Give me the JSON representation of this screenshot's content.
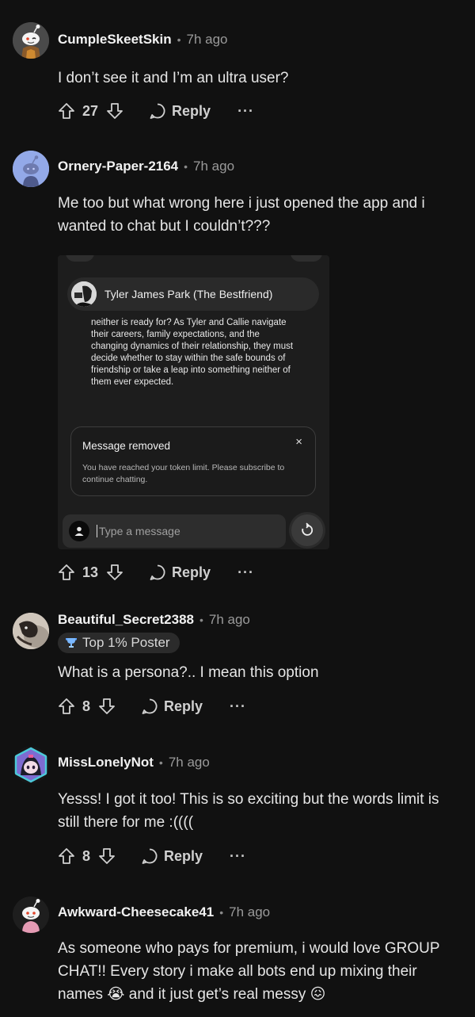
{
  "comments": [
    {
      "author": "CumpleSkeetSkin",
      "time": "7h ago",
      "text": "I don’t see it and I’m an ultra user?",
      "votes": "27",
      "reply_label": "Reply",
      "more_label": "···"
    },
    {
      "author": "Ornery-Paper-2164",
      "time": "7h ago",
      "text": "Me too but what wrong here i just opened the app and i wanted to chat but I couldn’t???",
      "votes": "13",
      "reply_label": "Reply",
      "more_label": "···",
      "screenshot": {
        "character_name": "Tyler James Park (The Bestfriend)",
        "story_text": "neither is ready for? As Tyler and Callie navigate their careers, family expectations, and the changing dynamics of their relationship, they must decide whether to stay within the safe bounds of friendship or take a leap into something neither of them ever expected.",
        "notice_title": "Message removed",
        "notice_close": "×",
        "notice_text": "You have reached your token limit. Please subscribe to continue chatting.",
        "input_placeholder": "Type a message"
      }
    },
    {
      "author": "Beautiful_Secret2388",
      "time": "7h ago",
      "flair": "Top 1% Poster",
      "text": "What is a persona?.. I mean this option",
      "votes": "8",
      "reply_label": "Reply",
      "more_label": "···"
    },
    {
      "author": "MissLonelyNot",
      "time": "7h ago",
      "text": "Yesss! I got it too! This is so exciting but the words limit is still there for me :((((",
      "votes": "8",
      "reply_label": "Reply",
      "more_label": "···"
    },
    {
      "author": "Awkward-Cheesecake41",
      "time": "7h ago",
      "text": "As someone who pays for premium, i would love GROUP CHAT!! Every story i make all bots end up mixing their names 😭 and it just get’s real messy 😖"
    }
  ],
  "colors": {
    "background": "#111111",
    "text": "#e4e4e4",
    "muted": "#9a9a9a",
    "flair_bg": "#2b2b2b"
  }
}
